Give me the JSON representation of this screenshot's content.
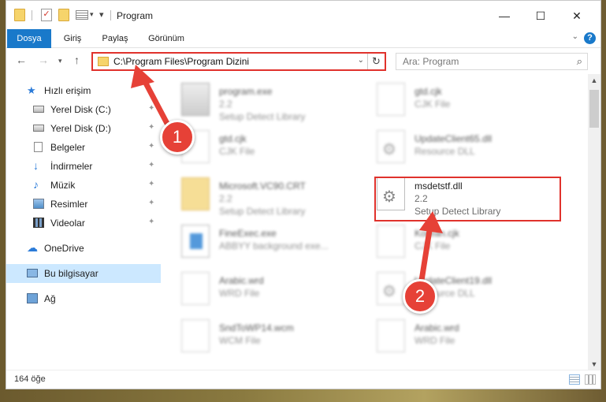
{
  "window": {
    "title": "Program"
  },
  "ribbon": {
    "tabs": [
      "Dosya",
      "Giriş",
      "Paylaş",
      "Görünüm"
    ],
    "help": "?"
  },
  "address": {
    "path": "C:\\Program Files\\Program Dizini"
  },
  "search": {
    "placeholder": "Ara: Program"
  },
  "nav": {
    "items": [
      {
        "label": "Hızlı erişim",
        "icon": "star-icon"
      },
      {
        "label": "Yerel Disk (C:)",
        "icon": "drive-icon",
        "pinned": true
      },
      {
        "label": "Yerel Disk (D:)",
        "icon": "drive-icon",
        "pinned": true
      },
      {
        "label": "Belgeler",
        "icon": "document-icon",
        "pinned": true
      },
      {
        "label": "İndirmeler",
        "icon": "download-icon",
        "pinned": true
      },
      {
        "label": "Müzik",
        "icon": "music-icon",
        "pinned": true
      },
      {
        "label": "Resimler",
        "icon": "picture-icon",
        "pinned": true
      },
      {
        "label": "Videolar",
        "icon": "video-icon",
        "pinned": true
      },
      {
        "label": "OneDrive",
        "icon": "cloud-icon"
      },
      {
        "label": "Bu bilgisayar",
        "icon": "computer-icon",
        "selected": true
      },
      {
        "label": "Ağ",
        "icon": "network-icon"
      }
    ]
  },
  "files": [
    {
      "name": "program.exe",
      "line2": "2.2",
      "line3": "Setup Detect Library",
      "kind": "exe"
    },
    {
      "name": "gtd.cjk",
      "line2": "CJK File",
      "line3": "",
      "kind": "file"
    },
    {
      "name": "gtd.cjk",
      "line2": "CJK File",
      "line3": "",
      "kind": "file"
    },
    {
      "name": "UpdateClient65.dll",
      "line2": "Resource DLL",
      "line3": "",
      "kind": "dll"
    },
    {
      "name": "Microsoft.VC90.CRT",
      "line2": "2.2",
      "line3": "Setup Detect Library",
      "kind": "folder"
    },
    {
      "name": "msdetstf.dll",
      "line2": "2.2",
      "line3": "Setup Detect Library",
      "kind": "dll",
      "highlighted": true
    },
    {
      "name": "FineExec.exe",
      "line2": "ABBYY background exe...",
      "line3": "",
      "kind": "app"
    },
    {
      "name": "Korean.cjk",
      "line2": "CJK File",
      "line3": "",
      "kind": "file"
    },
    {
      "name": "Arabic.wrd",
      "line2": "WRD File",
      "line3": "",
      "kind": "file"
    },
    {
      "name": "UpdateClient19.dll",
      "line2": "Resource DLL",
      "line3": "",
      "kind": "dll"
    },
    {
      "name": "SndToWP14.wcm",
      "line2": "WCM File",
      "line3": "",
      "kind": "file"
    },
    {
      "name": "Arabic.wrd",
      "line2": "WRD File",
      "line3": "",
      "kind": "file"
    }
  ],
  "status": {
    "count": "164 öğe"
  },
  "annotations": {
    "step1": "1",
    "step2": "2",
    "color": "#e64137"
  }
}
